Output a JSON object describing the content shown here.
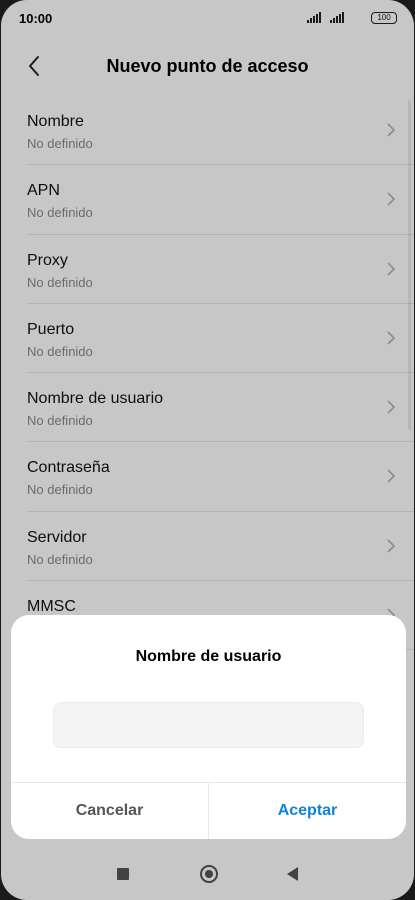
{
  "status_bar": {
    "time": "10:00",
    "battery": "100"
  },
  "header": {
    "title": "Nuevo punto de acceso"
  },
  "list": {
    "items": [
      {
        "title": "Nombre",
        "value": "No definido"
      },
      {
        "title": "APN",
        "value": "No definido"
      },
      {
        "title": "Proxy",
        "value": "No definido"
      },
      {
        "title": "Puerto",
        "value": "No definido"
      },
      {
        "title": "Nombre de usuario",
        "value": "No definido"
      },
      {
        "title": "Contraseña",
        "value": "No definido"
      },
      {
        "title": "Servidor",
        "value": "No definido"
      },
      {
        "title": "MMSC",
        "value": ""
      }
    ]
  },
  "dialog": {
    "title": "Nombre de usuario",
    "input_value": "",
    "cancel_label": "Cancelar",
    "accept_label": "Aceptar"
  },
  "colors": {
    "accent": "#0d84d7",
    "overlay": "#000000"
  },
  "icons": {
    "back": "chevron-left-icon",
    "item_arrow": "chevron-right-icon",
    "nav_recents": "square-icon",
    "nav_home": "circle-icon",
    "nav_back": "triangle-back-icon"
  }
}
